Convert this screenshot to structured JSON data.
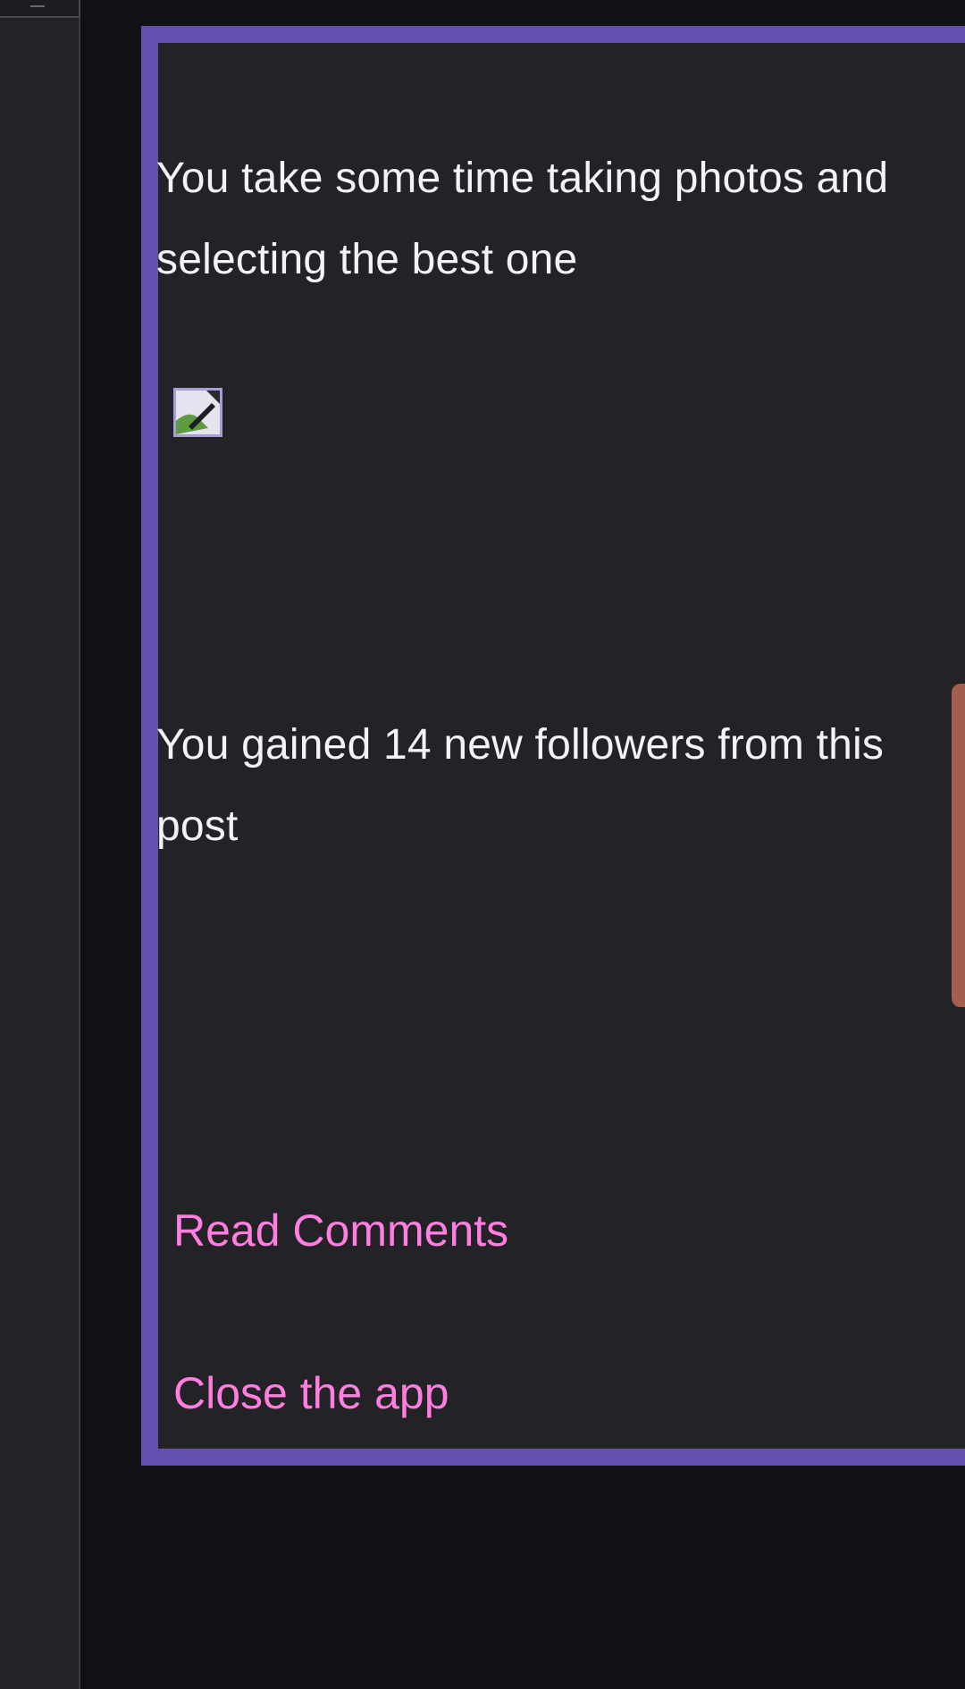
{
  "story": {
    "paragraph_1": "You take some time taking photos and selecting the best one",
    "image_alt": "broken-image-icon",
    "paragraph_2": "You gained 14 new followers from this post"
  },
  "choices": {
    "read_comments": "Read Comments",
    "close_app": "Close the app"
  },
  "colors": {
    "background": "#121115",
    "card_background": "#232226",
    "card_border": "#6550b0",
    "text": "#f3f2f5",
    "link": "#ff7ee0",
    "scroll_handle": "#a45e4e"
  }
}
